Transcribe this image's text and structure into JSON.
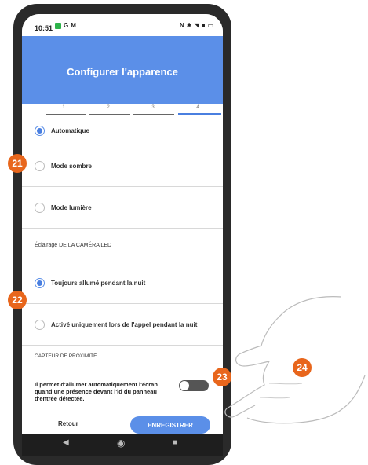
{
  "status_bar": {
    "time": "10:51",
    "icons_left": [
      "app-icon",
      "g-icon",
      "mail-icon"
    ],
    "icons_right": [
      "nfc-icon",
      "bluetooth-icon",
      "wifi-icon",
      "battery-icon"
    ]
  },
  "header": {
    "title": "Configurer l'apparence",
    "color": "#5b8fe8"
  },
  "stepper": {
    "steps": [
      "1",
      "2",
      "3",
      "4"
    ],
    "current": 4
  },
  "theme_options": [
    {
      "label": "Automatique",
      "selected": true
    },
    {
      "label": "Mode sombre",
      "selected": false
    },
    {
      "label": "Mode lumière",
      "selected": false
    }
  ],
  "led_section": {
    "title": "Éclairage DE LA CAMÉRA LED",
    "options": [
      {
        "label": "Toujours allumé pendant la nuit",
        "selected": true
      },
      {
        "label": "Activé uniquement lors de l'appel pendant la nuit",
        "selected": false
      }
    ]
  },
  "proximity": {
    "title": "CAPTEUR DE PROXIMITÉ",
    "description": "Il permet d'allumer automatiquement l'écran quand une présence devant l'id du panneau d'entrée détectée.",
    "enabled": false
  },
  "footer": {
    "back_label": "Retour",
    "save_label": "ENREGISTRER"
  },
  "annotations": [
    "21",
    "22",
    "23",
    "24"
  ],
  "accent_color": "#e8661c"
}
